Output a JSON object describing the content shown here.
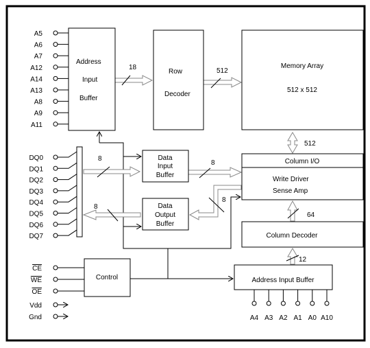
{
  "blocks": {
    "address_input_buffer_top": [
      "Address",
      "Input",
      "Buffer"
    ],
    "row_decoder": [
      "Row",
      "Decoder"
    ],
    "memory_array": [
      "Memory Array",
      "512 x 512"
    ],
    "column_io": "Column I/O",
    "write_driver": [
      "Write Driver",
      "Sense Amp"
    ],
    "column_decoder": "Column Decoder",
    "address_input_buffer_bottom": "Address Input Buffer",
    "data_input_buffer": [
      "Data",
      "Input",
      "Buffer"
    ],
    "data_output_buffer": [
      "Data",
      "Output",
      "Buffer"
    ],
    "control": "Control"
  },
  "bus_widths": {
    "row_in": "18",
    "row_out": "512",
    "array_io": "512",
    "data_in_left": "8",
    "data_in_right": "8",
    "data_out_left": "8",
    "data_out_right": "8",
    "col_dec": "64",
    "col_addr": "12"
  },
  "pins": {
    "address_top": [
      "A5",
      "A6",
      "A7",
      "A12",
      "A14",
      "A13",
      "A8",
      "A9",
      "A11"
    ],
    "dq": [
      "DQ0",
      "DQ1",
      "DQ2",
      "DQ3",
      "DQ4",
      "DQ5",
      "DQ6",
      "DQ7"
    ],
    "control": [
      "CE",
      "WE",
      "OE"
    ],
    "power": [
      "Vdd",
      "Gnd"
    ],
    "address_bottom": [
      "A4",
      "A3",
      "A2",
      "A1",
      "A0",
      "A10"
    ]
  }
}
